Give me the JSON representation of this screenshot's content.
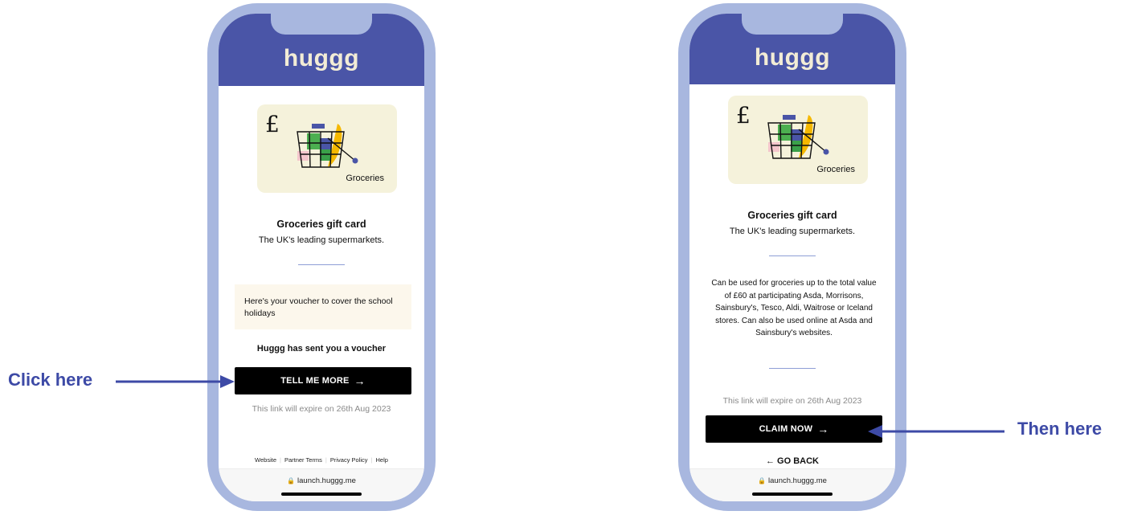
{
  "left_screen": {
    "logo": "huggg",
    "card_label": "Groceries",
    "card_symbol": "£",
    "title": "Groceries gift card",
    "subtitle": "The UK's leading supermarkets.",
    "message": "Here's your voucher to cover the school holidays",
    "sent_text": "Huggg has sent you a voucher",
    "cta_label": "TELL ME MORE",
    "cta_arrow": "→",
    "expiry": "This link will expire on 26th Aug 2023",
    "footer_links": [
      "Website",
      "Partner Terms",
      "Privacy Policy",
      "Help"
    ],
    "url": "launch.huggg.me"
  },
  "right_screen": {
    "logo": "huggg",
    "card_label": "Groceries",
    "card_symbol": "£",
    "title": "Groceries gift card",
    "subtitle": "The UK's leading supermarkets.",
    "description": "Can be used for groceries up to the total value of £60 at participating Asda, Morrisons, Sainsbury's, Tesco, Aldi, Waitrose or Iceland stores. Can also be used online at Asda and Sainsbury's websites.",
    "expiry": "This link will expire on 26th Aug 2023",
    "cta_label": "CLAIM NOW",
    "cta_arrow": "→",
    "back_label": "← GO BACK",
    "url": "launch.huggg.me"
  },
  "annotations": {
    "left": "Click here",
    "right": "Then here"
  },
  "colors": {
    "brand_header": "#4a55a7",
    "phone_frame": "#a8b7df",
    "logo_text": "#f2ecd6",
    "card_background": "#f5f2db",
    "annotation": "#3d4aa6",
    "button": "#000000"
  }
}
